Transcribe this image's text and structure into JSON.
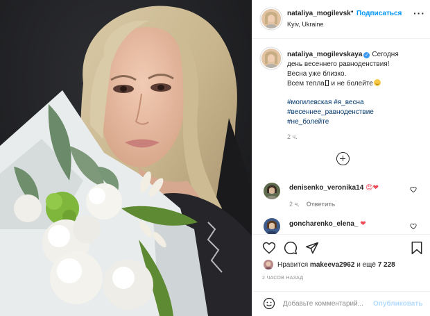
{
  "post": {
    "username": "nataliya_mogilevsk",
    "follow_label": "Подписаться",
    "location": "Kyiv, Ukraine",
    "more_label": "···"
  },
  "caption": {
    "username": "nataliya_mogilevskaya",
    "line1": "Сегодня",
    "line2": "день весеннего равноденствия!",
    "line3": "Весна уже близко.",
    "line4a": "Всем тепла",
    "line4b": " и не болейте",
    "hashtags": [
      "#могилевская",
      "#я_весна",
      "#весеннее_равноденствие",
      "#не_болейте"
    ],
    "age": "2 ч."
  },
  "comments": [
    {
      "username": "denisenko_veronika14",
      "emoji": "😍❤",
      "age": "2 ч.",
      "reply_label": "Ответить"
    },
    {
      "username": "goncharenko_elena_",
      "emoji": "❤"
    }
  ],
  "likes": {
    "prefix": "Нравится",
    "user": "makeeva2962",
    "middle": "и ещё",
    "count": "7 228"
  },
  "time_ago": "2 ЧАСОВ НАЗАД",
  "add_comment": {
    "placeholder": "Добавьте комментарий...",
    "post_label": "Опубликовать"
  },
  "icons": {
    "like": "heart-icon",
    "comment": "comment-icon",
    "share": "paper-plane-icon",
    "save": "bookmark-icon",
    "emoji": "smiley-icon",
    "more": "ellipsis-icon",
    "load": "plus-circle-icon"
  },
  "colors": {
    "link_blue": "#0095f6",
    "hashtag": "#00376b",
    "muted": "#8e8e8e",
    "verified": "#3897f0",
    "heart_red": "#ed4956"
  }
}
